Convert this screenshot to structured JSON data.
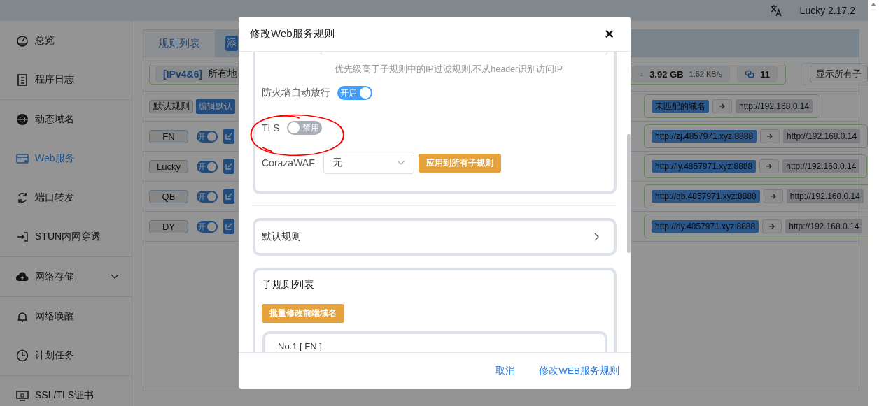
{
  "top_bar": {
    "version": "Lucky 2.17.2"
  },
  "sidebar": {
    "groups": [
      {
        "items": [
          {
            "label": "总览",
            "kind": "link",
            "selected": false
          },
          {
            "label": "程序日志",
            "kind": "link",
            "selected": false
          }
        ]
      },
      {
        "items": [
          {
            "label": "动态域名",
            "kind": "link",
            "selected": false
          },
          {
            "label": "Web服务",
            "kind": "link",
            "selected": true
          },
          {
            "label": "端口转发",
            "kind": "link",
            "selected": false
          },
          {
            "label": "STUN内网穿透",
            "kind": "link",
            "selected": false
          }
        ]
      },
      {
        "items": [
          {
            "label": "网络存储",
            "kind": "menu",
            "selected": false
          }
        ]
      },
      {
        "items": [
          {
            "label": "网络唤醒",
            "kind": "link",
            "selected": false
          },
          {
            "label": "计划任务",
            "kind": "link",
            "selected": false
          }
        ]
      },
      {
        "items": [
          {
            "label": "SSL/TLS证书",
            "kind": "link",
            "selected": false
          }
        ]
      }
    ]
  },
  "main": {
    "tabs": [
      {
        "label": "规则列表",
        "selected": true
      }
    ],
    "add_button": "添",
    "info_bar": {
      "ip_type": "[IPv4&6]",
      "address": "所有地",
      "upload_total": "3.92 GB",
      "upload_rate": "1.52 KB/s",
      "connections": "11",
      "show_all_button": "显示所有子"
    },
    "default_rule": {
      "label": "默认规则",
      "edit_button": "编辑默认",
      "domain": "未匹配的域名",
      "target": "http://192.168.0.14"
    },
    "rules": [
      {
        "name": "FN",
        "enabled": true,
        "switch_label": "开",
        "domain": "http://zj.4857971.xyz:8888",
        "target": "http://192.168.0.14"
      },
      {
        "name": "Lucky",
        "enabled": true,
        "switch_label": "开",
        "domain": "http://ly.4857971.xyz:8888",
        "target": "http://192.168.0.14"
      },
      {
        "name": "QB",
        "enabled": true,
        "switch_label": "开",
        "domain": "http://qb.4857971.xyz:8888",
        "target": "http://192.168.0.14"
      },
      {
        "name": "DY",
        "enabled": true,
        "switch_label": "开",
        "domain": "http://dy.4857971.xyz:8888",
        "target": "http://192.168.0.14"
      }
    ]
  },
  "dialog": {
    "title": "修改Web服务规则",
    "close": "×",
    "hint": "优先级高于子规则中的IP过滤规则,不从header识别访问IP",
    "fields": [
      {
        "kind": "switch",
        "label": "防火墙自动放行",
        "on": true,
        "state_label": "开启"
      },
      {
        "kind": "switch",
        "label": "TLS",
        "on": false,
        "state_label": "禁用"
      },
      {
        "kind": "select",
        "label": "CorazaWAF",
        "value": "无",
        "button": "应用到所有子规则"
      }
    ],
    "default_rule": "默认规则",
    "subrules": {
      "title": "子规则列表",
      "batch_button": "批量修改前端域名",
      "items": [
        "No.1 [ FN ]"
      ]
    },
    "buttons": [
      "取消",
      "修改WEB服务规则"
    ]
  }
}
